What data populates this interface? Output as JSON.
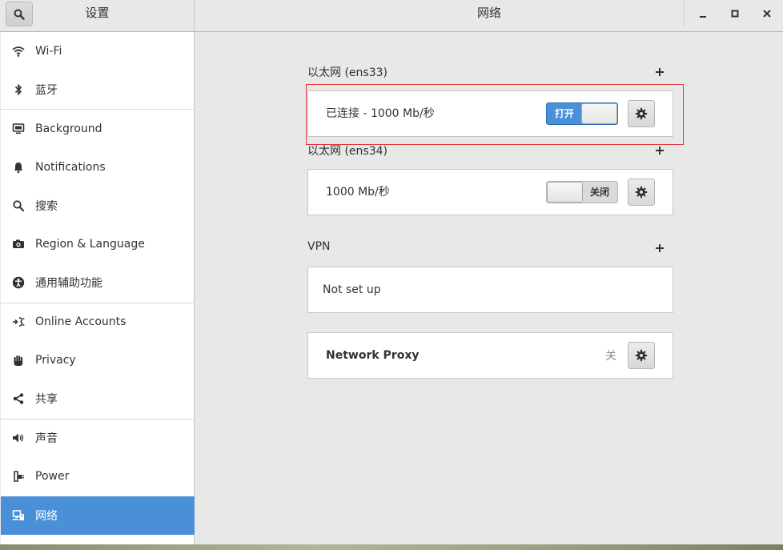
{
  "header": {
    "sidebar_title": "设置",
    "title": "网络"
  },
  "sidebar": {
    "items": [
      {
        "label": "Wi-Fi",
        "icon": "wifi-icon"
      },
      {
        "label": "蓝牙",
        "icon": "bluetooth-icon"
      },
      {
        "label": "Background",
        "icon": "display-icon"
      },
      {
        "label": "Notifications",
        "icon": "bell-icon"
      },
      {
        "label": "搜索",
        "icon": "search-icon"
      },
      {
        "label": "Region & Language",
        "icon": "camera-icon"
      },
      {
        "label": "通用辅助功能",
        "icon": "accessibility-icon"
      },
      {
        "label": "Online Accounts",
        "icon": "online-accounts-icon"
      },
      {
        "label": "Privacy",
        "icon": "hand-icon"
      },
      {
        "label": "共享",
        "icon": "share-icon"
      },
      {
        "label": "声音",
        "icon": "speaker-icon"
      },
      {
        "label": "Power",
        "icon": "power-plug-icon"
      },
      {
        "label": "网络",
        "icon": "network-icon",
        "active": true
      }
    ]
  },
  "main": {
    "ethernet1": {
      "title": "以太网 (ens33)",
      "status": "已连接 - 1000  Mb/秒",
      "toggle_label": "打开",
      "toggle_on": true
    },
    "ethernet2": {
      "title": "以太网 (ens34)",
      "status": "1000 Mb/秒",
      "toggle_label": "关闭",
      "toggle_on": false
    },
    "vpn": {
      "title": "VPN",
      "status": "Not set up"
    },
    "proxy": {
      "title": "Network Proxy",
      "status": "关"
    }
  },
  "colors": {
    "accent": "#4a90d9",
    "highlight": "#e0393e"
  }
}
